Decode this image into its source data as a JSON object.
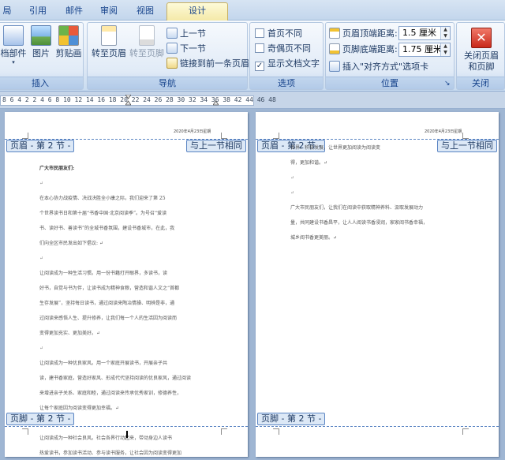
{
  "tabs": [
    "局",
    "引用",
    "邮件",
    "审阅",
    "视图",
    "设计"
  ],
  "active_tab": "设计",
  "ribbon": {
    "insert_group": {
      "label": "插入",
      "buttons": [
        "档部件",
        "图片",
        "剪贴画"
      ]
    },
    "nav_group": {
      "label": "导航",
      "goto_header": "转至页眉",
      "goto_footer": "转至页脚",
      "prev": "上一节",
      "next": "下一节",
      "link_prev": "链接到前一条页眉"
    },
    "options_group": {
      "label": "选项",
      "first_page": "首页不同",
      "odd_even": "奇偶页不同",
      "show_text": "显示文档文字",
      "show_text_checked": "✓"
    },
    "position_group": {
      "label": "位置",
      "header_top_label": "页眉顶端距离:",
      "header_top_value": "1.5 厘米",
      "footer_bottom_label": "页脚底端距离:",
      "footer_bottom_value": "1.75 厘米",
      "insert_align": "插入\"对齐方式\"选项卡"
    },
    "close_group": {
      "label": "关闭",
      "close_line1": "关闭页眉",
      "close_line2": "和页脚"
    }
  },
  "ruler": "8 6 4 2   2 4 6 8 10 12 14 16 18 20 22 24 26 28 30 32 34 36 38   42 44 46 48",
  "pages": [
    {
      "date": "2020年4月23日星期",
      "header_tag": "页眉 - 第 2 节 -",
      "same_as_prev": "与上一节相同",
      "footer_tag": "页脚 - 第 2 节 -",
      "lines": [
        "广大市民朋友们:",
        "↵",
        "在本心协力战疫情、决战决胜全小康之际，我们迎来了第 25",
        "个世界读书日和第十届“书香中国·北京阅读季”。为号召“爱读",
        "书、读好书、善读书”的全城书香氛围，建设书香城市，在此，我",
        "们向全区市民发出如下倡议: ↵",
        "↵",
        "让阅读成为一种生活习惯。用一份书籍打开眼界，多读书，读",
        "好书，自觉与书为伴，让读书成为精神食粮，营造和谐人文之“首都",
        "生存发展”，坚持每日读书，通过阅读来陶冶情操、明辨是非，通",
        "过阅读来感悟人生、提升修养，让我们每一个人的生活因为阅读而",
        "变得更加充实、更加美好。↵",
        "↵",
        "让阅读成为一种优良家风。用一个家庭开展读书，开展亲子共",
        "读，建书香家庭，营造好家风、形成代代坚持阅读的优良家风，通过阅读",
        "来增进亲子关系、家庭和睦，通过阅读来传承优秀家训，修德养性，",
        "让每个家庭因为阅读变得更加幸福。↵",
        "↵",
        "让阅读成为一种社会良风。社会各界行动起来，带动身边人读书",
        "热爱读书，参加读书活动、参与读书服务，让社会因为阅读变得更加"
      ]
    },
    {
      "date": "2020年4月23日星期",
      "header_tag": "页眉 - 第 2 节 -",
      "same_as_prev": "与上一节相同",
      "footer_tag": "页脚 - 第 2 节 -",
      "lines": [
        "                      各界、积极发展，让世界更加阅读为阅读变",
        "得，更加和谐。↵",
        "↵",
        "↵",
        "广大市民朋友们，让我们在阅读中获取精神养料、汲取发展动力",
        "量，共同建设书香昌平，让人人阅读书香浸润，家家阅书香幸福，",
        "城乡阅书香更美丽。↵"
      ]
    }
  ]
}
